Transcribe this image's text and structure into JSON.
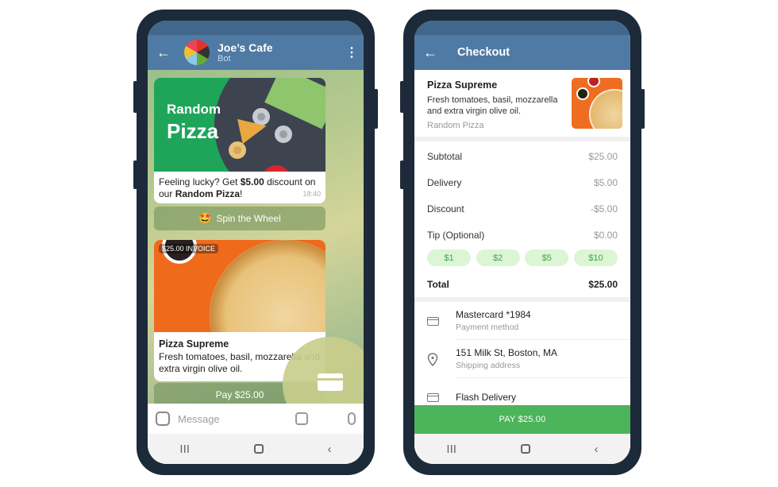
{
  "chat_screen": {
    "header": {
      "back_icon": "arrow-left-icon",
      "title": "Joe’s Cafe",
      "subtitle": "Bot",
      "menu_icon": "more-vertical-icon"
    },
    "promo_message": {
      "banner_line1": "Random",
      "banner_line2": "Pizza",
      "text_prefix": "Feeling lucky? Get ",
      "text_bold_amount": "$5.00",
      "text_middle": " discount on our ",
      "text_bold_product": "Random Pizza",
      "text_suffix": "!",
      "time": "18:40",
      "button_emoji": "🤩",
      "button_label": "Spin the Wheel"
    },
    "invoice_message": {
      "tag": "$25.00 INVOICE",
      "title": "Pizza Supreme",
      "description": "Fresh tomatoes, basil, mozzarella and extra virgin olive oil.",
      "pay_button": "Pay $25.00"
    },
    "input": {
      "placeholder": "Message",
      "sticker_icon": "sticker-icon",
      "attach_icon": "command-icon",
      "mic_icon": "microphone-icon"
    }
  },
  "checkout_screen": {
    "header": {
      "back_icon": "arrow-left-icon",
      "title": "Checkout"
    },
    "item": {
      "name": "Pizza Supreme",
      "description": "Fresh tomatoes, basil, mozzarella and extra virgin olive oil.",
      "seller": "Random Pizza"
    },
    "lines": [
      {
        "label": "Subtotal",
        "value": "$25.00"
      },
      {
        "label": "Delivery",
        "value": "$5.00"
      },
      {
        "label": "Discount",
        "value": "-$5.00"
      },
      {
        "label": "Tip (Optional)",
        "value": "$0.00"
      }
    ],
    "tips": [
      "$1",
      "$2",
      "$5",
      "$10"
    ],
    "total": {
      "label": "Total",
      "value": "$25.00"
    },
    "options": [
      {
        "icon": "credit-card-icon",
        "main": "Mastercard *1984",
        "sub": "Payment method"
      },
      {
        "icon": "location-pin-icon",
        "main": "151 Milk St, Boston, MA",
        "sub": "Shipping address"
      },
      {
        "icon": "delivery-icon",
        "main": "Flash Delivery",
        "sub": ""
      }
    ],
    "pay_button": "PAY $25.00"
  },
  "navbar": {
    "recents_icon": "recents-icon",
    "home_icon": "home-icon",
    "back_icon": "back-chevron-icon",
    "recents_glyph": "III",
    "back_glyph": "‹"
  },
  "colors": {
    "header": "#4f7aa3",
    "pay_green": "#4cb45a",
    "tip_bg": "#dcf5d5",
    "tip_text": "#3ea64a",
    "promo_green": "#1fa55a"
  }
}
